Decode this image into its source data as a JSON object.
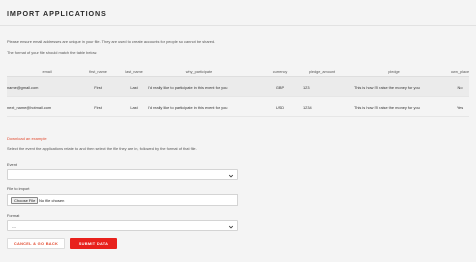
{
  "header": {
    "title": "IMPORT APPLICATIONS"
  },
  "intro": {
    "line1": "Please ensure email addresses are unique in your file. They are used to create accounts for people so cannot be shared.",
    "line2": "The format of your file should match the table below."
  },
  "table": {
    "columns": [
      "email",
      "first_name",
      "last_name",
      "why_participate",
      "currency",
      "pledge_amount",
      "pledge",
      "own_place"
    ],
    "rows": [
      [
        "name@gmail.com",
        "First",
        "Last",
        "I'd really like to participate in this event for you",
        "GBP",
        "123",
        "This is how I'll raise the money for you",
        "No"
      ],
      [
        "next_name@hotmail.com",
        "First",
        "Last",
        "I'd really like to participate in this event for you",
        "USD",
        "1234",
        "This is how I'll raise the money for you",
        "Yes"
      ]
    ]
  },
  "download_link": "Download an example",
  "instruction": "Select the event the applications relate to and then select the file they are in, followed by the format of that file.",
  "form": {
    "event_label": "Event",
    "event_value": "",
    "file_label": "File to import",
    "file_button": "Choose File",
    "file_status": "No file chosen",
    "format_label": "Format",
    "format_value": "---"
  },
  "actions": {
    "cancel": "CANCEL & GO BACK",
    "submit": "SUBMIT DATA"
  },
  "colors": {
    "accent": "#e8211c",
    "link": "#e24a2f"
  }
}
